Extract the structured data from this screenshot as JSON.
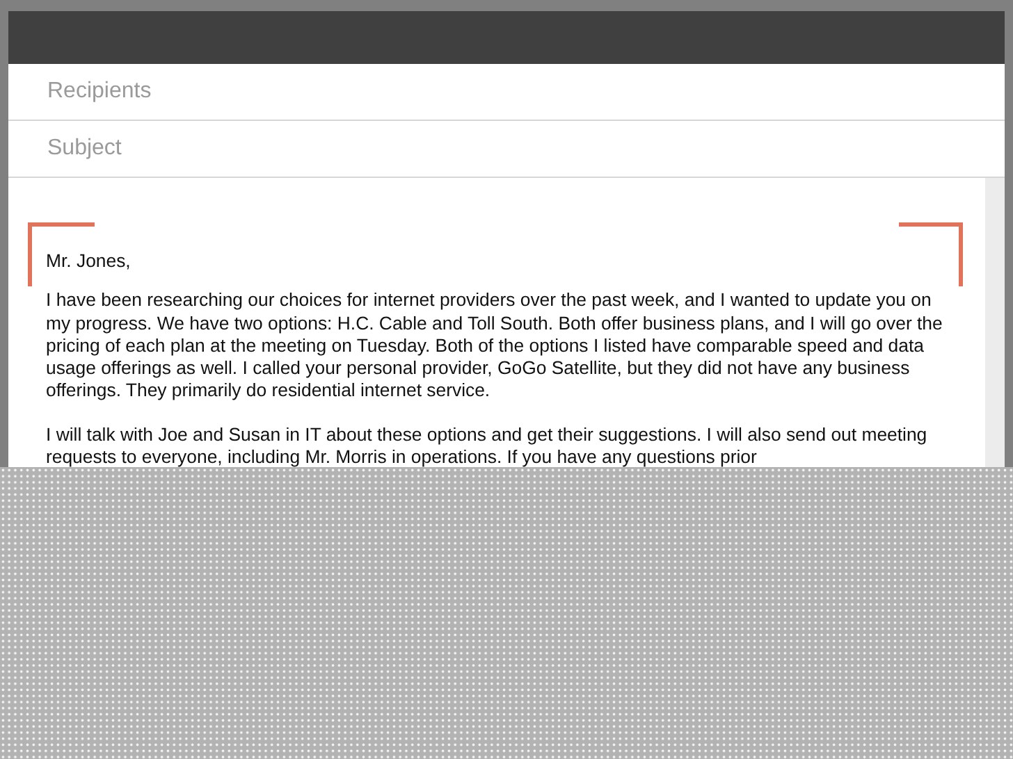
{
  "fields": [
    {
      "placeholder": "Recipients"
    },
    {
      "placeholder": "Subject"
    }
  ],
  "body": {
    "greeting": "Mr. Jones,",
    "paragraphs": [
      "I have been researching our choices for internet providers over the past week, and I wanted to update you on my progress. We have two options: H.C. Cable and Toll South. Both offer business plans, and I will go over the pricing of each plan at the meeting on Tuesday. Both of the options I listed have comparable speed and data usage offerings as well. I called your personal provider, GoGo Satellite, but they did not have any business offerings. They primarily do residential internet service.",
      "I will talk with Joe and Susan in IT about these options and get their suggestions. I will also send out meeting requests to everyone, including Mr. Morris in operations. If you have any questions prior"
    ]
  }
}
